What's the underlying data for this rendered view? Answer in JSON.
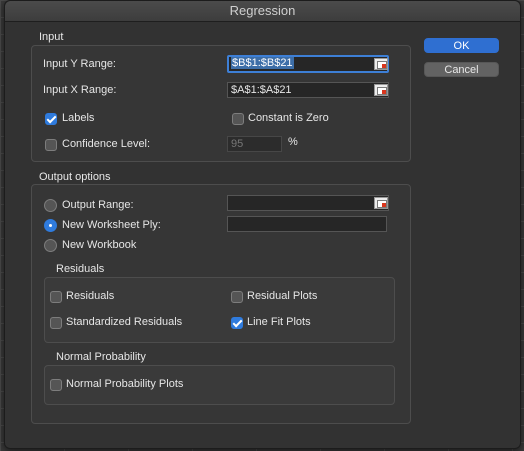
{
  "dialog": {
    "title": "Regression"
  },
  "buttons": {
    "ok": "OK",
    "cancel": "Cancel"
  },
  "input": {
    "section_title": "Input",
    "y_range_label": "Input Y Range:",
    "y_range_value": "$B$1:$B$21",
    "x_range_label": "Input X Range:",
    "x_range_value": "$A$1:$A$21",
    "labels_label": "Labels",
    "labels_checked": true,
    "constant_zero_label": "Constant is Zero",
    "constant_zero_checked": false,
    "confidence_label": "Confidence Level:",
    "confidence_checked": false,
    "confidence_value": "95",
    "percent_sign": "%"
  },
  "output": {
    "section_title": "Output options",
    "output_range_label": "Output Range:",
    "output_range_value": "",
    "new_ply_label": "New Worksheet Ply:",
    "new_ply_value": "",
    "new_workbook_label": "New Workbook",
    "selected": "new_worksheet_ply"
  },
  "residuals": {
    "title": "Residuals",
    "residuals_label": "Residuals",
    "residuals_checked": false,
    "residual_plots_label": "Residual Plots",
    "residual_plots_checked": false,
    "standardized_label": "Standardized Residuals",
    "standardized_checked": false,
    "line_fit_label": "Line Fit Plots",
    "line_fit_checked": true
  },
  "normal_probability": {
    "title": "Normal Probability",
    "plots_label": "Normal Probability Plots",
    "plots_checked": false
  },
  "colors": {
    "accent": "#2f7bdd",
    "button_primary": "#2f6fd1"
  }
}
